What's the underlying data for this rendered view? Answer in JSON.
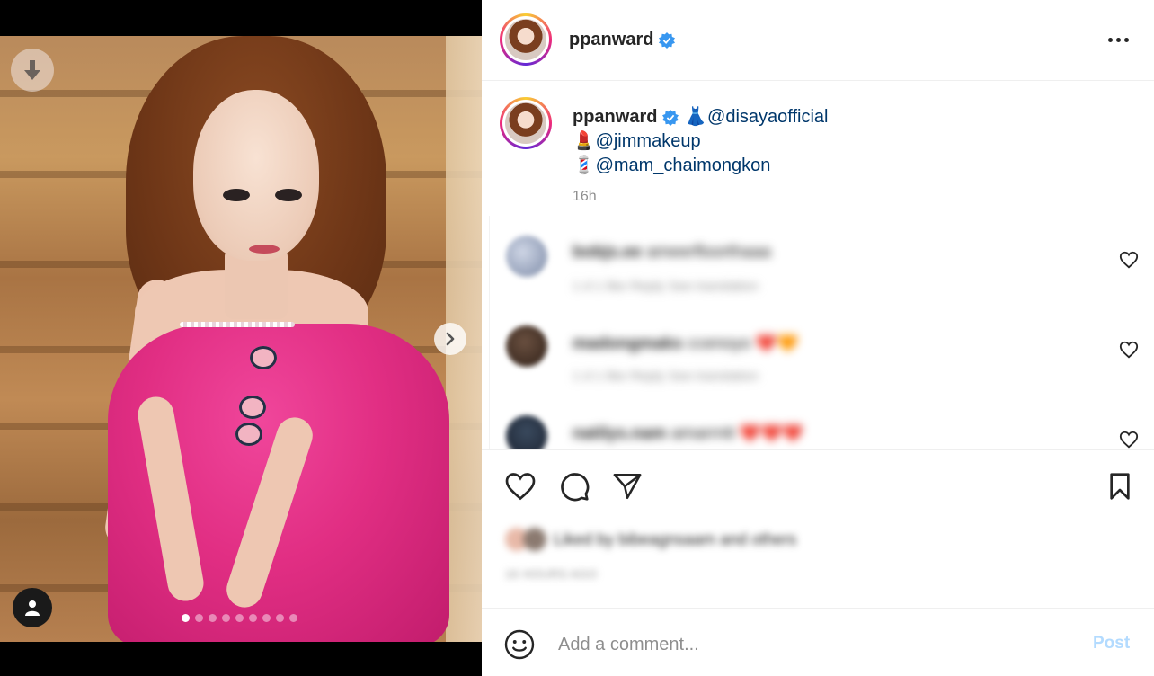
{
  "post": {
    "username": "ppanward",
    "verified": true,
    "caption_lines": [
      {
        "emoji": "👗",
        "mention": "@disayaofficial"
      },
      {
        "emoji": "💄",
        "mention": "@jimmakeup"
      },
      {
        "emoji": "💈",
        "mention": "@mam_chaimongkon"
      }
    ],
    "time_ago": "16h"
  },
  "media": {
    "slide_count": 9,
    "active_slide": 1
  },
  "comments": [
    {
      "username": "bobjs.ee",
      "text": "ameerfloorthaaa",
      "meta": "1 d 1 like Reply See translation"
    },
    {
      "username": "madongmaks",
      "text": "ccenoyo ❤️🧡",
      "meta": "1 d 1 like Reply See translation"
    },
    {
      "username": "natilys.nam",
      "text": "amarrntt ❤️❤️❤️",
      "meta": ""
    }
  ],
  "actions": {
    "liked_by_text": "Liked by bibeagnsaam and others",
    "date_text": "16 HOURS AGO"
  },
  "comment_bar": {
    "placeholder": "Add a comment...",
    "post_label": "Post"
  },
  "colors": {
    "mention": "#00376b",
    "verified": "#3897f0",
    "post_disabled": "#b3dbff"
  }
}
